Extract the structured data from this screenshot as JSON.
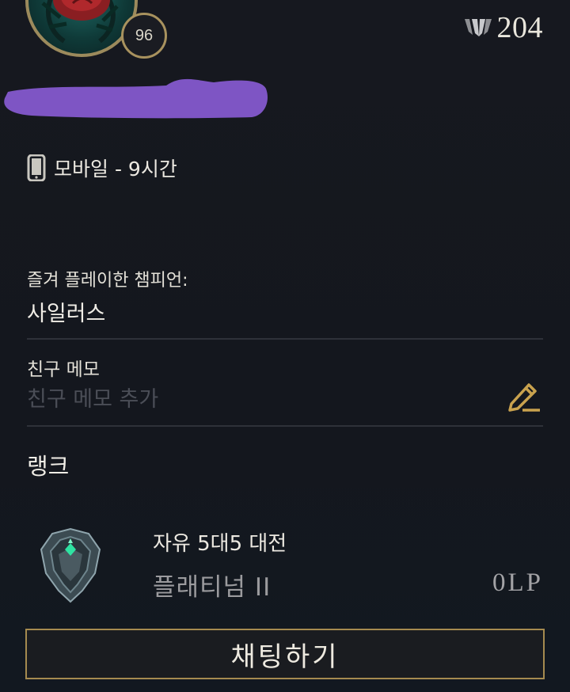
{
  "profile": {
    "level": "96",
    "honor_value": "204",
    "icons": {
      "avatar": "rose-icon",
      "honor": "honor-icon",
      "status": "mobile-phone-icon",
      "edit": "pencil-edit-icon",
      "rank": "platinum-emblem-icon"
    }
  },
  "status": {
    "text": "모바일 - 9시간"
  },
  "favorite_champion": {
    "label": "즐겨 플레이한 챔피언:",
    "value": "사일러스"
  },
  "friend_memo": {
    "label": "친구 메모",
    "placeholder": "친구 메모 추가"
  },
  "rank": {
    "heading": "랭크",
    "queue_name": "자유 5대5 대전",
    "tier": "플래티넘 II",
    "lp": "0LP"
  },
  "actions": {
    "chat_label": "채팅하기"
  },
  "colors": {
    "background": "#151820",
    "gold": "#a58a4f",
    "redaction": "#7e55c4"
  }
}
